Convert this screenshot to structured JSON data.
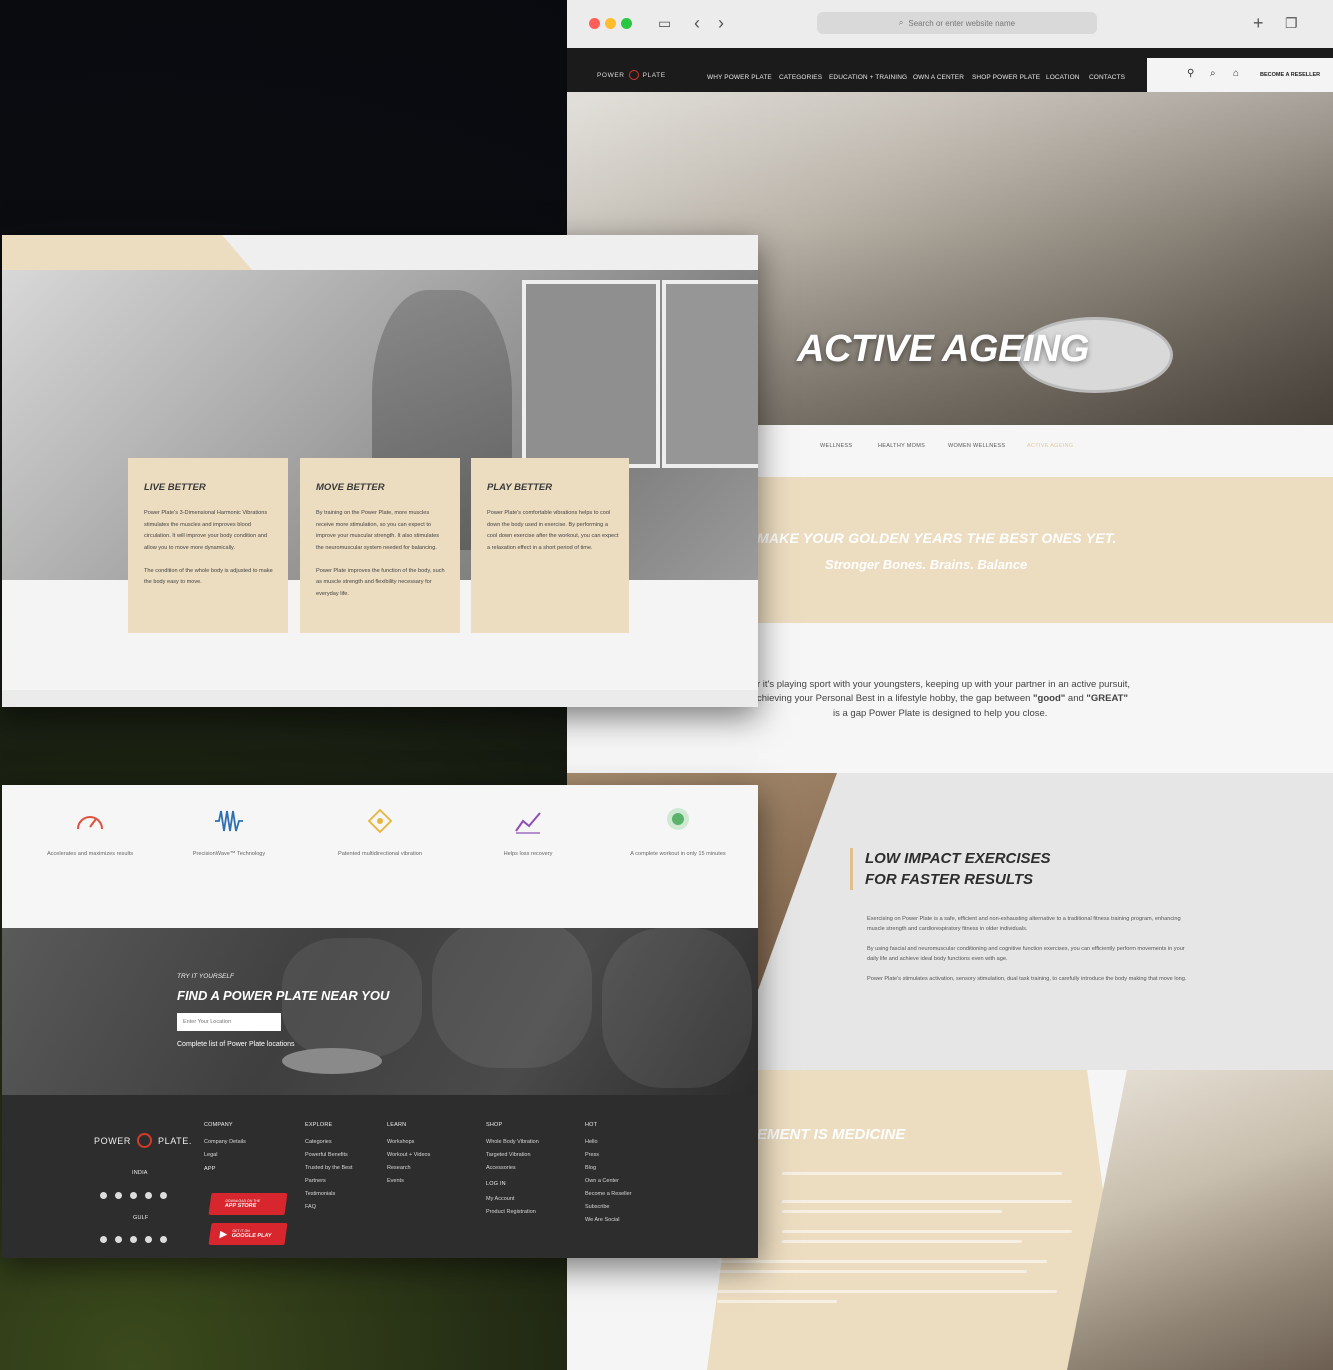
{
  "browser": {
    "address_placeholder": "Search or enter website name"
  },
  "site": {
    "logo": [
      "POWER",
      "PLATE"
    ],
    "nav": [
      "WHY POWER PLATE",
      "CATEGORIES",
      "EDUCATION + TRAINING",
      "OWN A CENTER",
      "SHOP POWER PLATE",
      "LOCATION",
      "CONTACTS"
    ],
    "reseller": "BECOME A RESELLER"
  },
  "hero": {
    "title": "ACTIVE AGEING"
  },
  "tabs": [
    "WELLNESS",
    "HEALTHY MOMS",
    "WOMEN WELLNESS",
    "ACTIVE AGEING"
  ],
  "banner": {
    "line1": "MAKE YOUR GOLDEN YEARS THE BEST ONES YET.",
    "line2": "Stronger Bones. Brains. Balance"
  },
  "intro": {
    "line1": "r it's playing sport with your youngsters, keeping up with your partner in an active pursuit,",
    "line2_a": "chieving your Personal Best in a lifestyle hobby, the gap between ",
    "good": "\"good\"",
    "and": " and ",
    "great": "\"GREAT\"",
    "line3": "is a gap Power Plate is designed to help you close."
  },
  "low_impact": {
    "title_1": "LOW IMPACT EXERCISES",
    "title_2": "FOR FASTER RESULTS",
    "p1": "Exercising on Power Plate is a safe, efficient and non-exhausting alternative to a traditional fitness training program, enhancing muscle strength and cardiorespiratory fitness in older individuals.",
    "p2": "By using fascial and neuromuscular conditioning and cognitive function exercises, you can efficiently perform movements in your daily life and achieve ideal body functions even with age.",
    "p3": "Power Plate's stimulates activation, sensory stimulation, dual task training, to carefully introduce the body making that move long."
  },
  "movement": {
    "title": "EMENT IS MEDICINE"
  },
  "features": [
    {
      "title": "LIVE BETTER",
      "p1": "Power Plate's 3-Dimensional Harmonic Vibrations stimulates the muscles and improves blood circulation. It will improve your body condition and allow you to move more dynamically.",
      "p2": "The condition of the whole body is adjusted to make the body easy to move."
    },
    {
      "title": "MOVE BETTER",
      "p1": "By training on the Power Plate, more muscles receive more stimulation, so you can expect to improve your muscular strength. It also stimulates the neuromuscular system needed for balancing.",
      "p2": "Power Plate improves the function of the body, such as muscle strength and flexibility necessary for everyday life."
    },
    {
      "title": "PLAY BETTER",
      "p1": "Power Plate's comfortable vibrations helps to cool down the body used in exercise. By performing a cool down exercise after the workout, you can expect a relaxation effect in a short period of time.",
      "p2": ""
    }
  ],
  "icons": [
    {
      "label": "Accelerates and maximizes results",
      "icon": "gauge-icon",
      "color": "#e0523f"
    },
    {
      "label": "PrecisionWave™ Technology",
      "icon": "wave-icon",
      "color": "#2f6fb3"
    },
    {
      "label": "Patented multidirectional vibration",
      "icon": "vibration-icon",
      "color": "#e9b43a"
    },
    {
      "label": "Helps loss recovery",
      "icon": "chart-icon",
      "color": "#8e4fb3"
    },
    {
      "label": "A complete workout in only 15 minutes",
      "icon": "timer-icon",
      "color": "#5bb36b"
    }
  ],
  "locator": {
    "kicker": "TRY IT YOURSELF",
    "title": "FIND A POWER PLATE NEAR YOU",
    "placeholder": "Enter Your Location",
    "link": "Complete list of Power Plate locations"
  },
  "footer": {
    "logo": [
      "POWER",
      "PLATE."
    ],
    "region1": "INDIA",
    "region2": "GULF",
    "columns": [
      {
        "head": "COMPANY",
        "items": [
          "Company Details",
          "Legal"
        ]
      },
      {
        "head": "EXPLORE",
        "items": [
          "Categories",
          "Powerful Benefits",
          "Trusted by the Best",
          "Partners",
          "Testimonials",
          "FAQ"
        ]
      },
      {
        "head": "LEARN",
        "items": [
          "Workshops",
          "Workout + Videos",
          "Research",
          "Events"
        ]
      },
      {
        "head": "SHOP",
        "items": [
          "Whole Body Vibration",
          "Targeted Vibration",
          "Accessories"
        ]
      },
      {
        "head": "HOT",
        "items": [
          "Hello",
          "Press",
          "Blog",
          "Own a Center",
          "Become a Reseller",
          "Subscribe",
          "We Are Social"
        ]
      }
    ],
    "app_head": "APP",
    "login_head": "LOG IN",
    "login_items": [
      "My Account",
      "Product Registration"
    ],
    "app_store_small": "DOWNLOAD ON THE",
    "app_store": "APP STORE",
    "google_small": "GET IT ON",
    "google": "GOOGLE PLAY"
  },
  "colors": {
    "accent": "#ecdcc0",
    "brand_red": "#d43a2c",
    "dark": "#1b1b1b"
  }
}
